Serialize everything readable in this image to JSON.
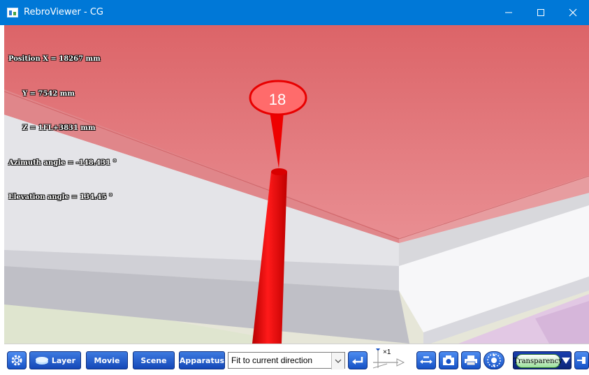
{
  "window": {
    "title": "RebroViewer - CG"
  },
  "overlay": {
    "position_x": "Position X = 18267 mm",
    "position_y": "Y = 7542 mm",
    "position_z": "Z = 1FL+3831 mm",
    "azimuth": "Azimuth angle = -148.431 °",
    "elevation": "Elevation angle = 134.45 °"
  },
  "scene": {
    "marker_label": "18",
    "accent_color": "#e60000",
    "ceiling_color": "#e0696e"
  },
  "toolbar": {
    "layer_label": "Layer",
    "movie_label": "Movie",
    "scene_label": "Scene",
    "apparatus_label": "Apparatus",
    "view_select_value": "Fit to current direction",
    "speed_label": "×1",
    "transparency_label": "Transparency"
  },
  "icons": [
    "gear-icon",
    "layer-icon",
    "enter-icon",
    "speed-arrow-icon",
    "fit-icon",
    "camera-icon",
    "print-icon",
    "walk-icon",
    "pin-icon"
  ]
}
